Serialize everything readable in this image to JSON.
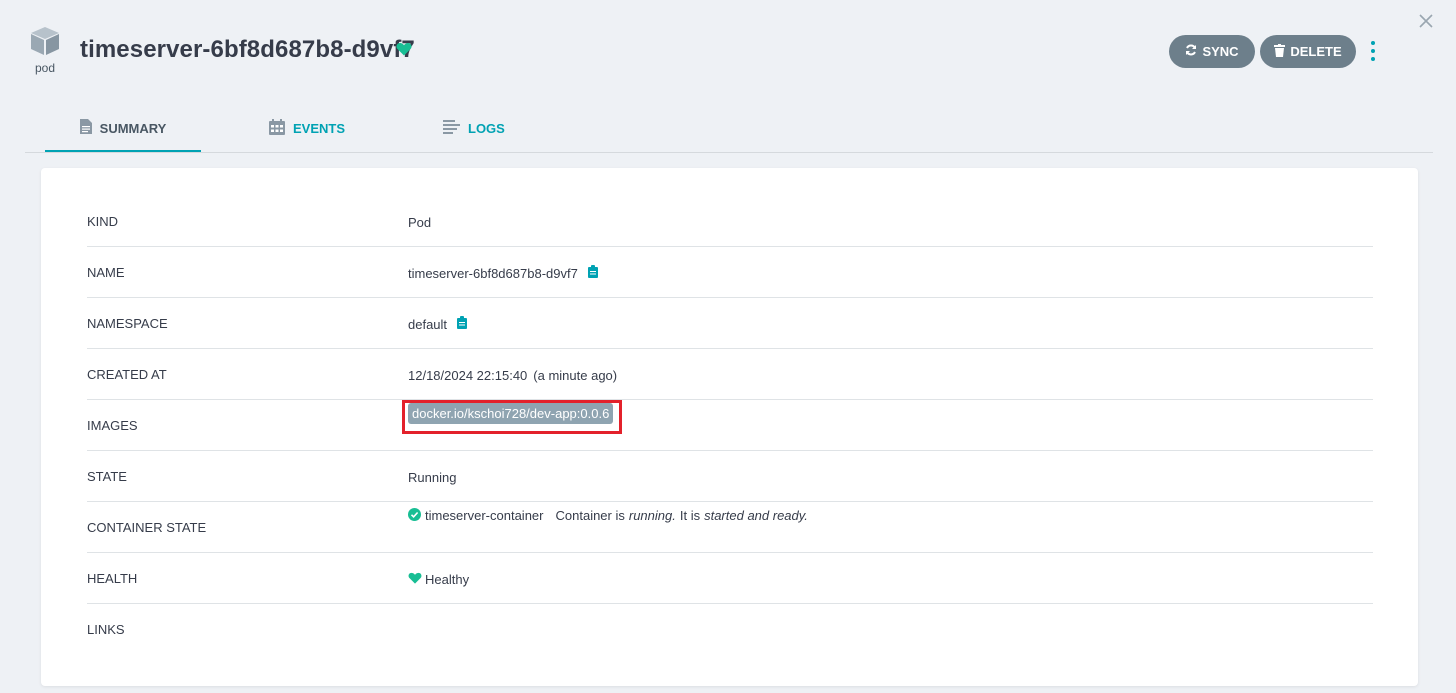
{
  "header": {
    "kind_label": "pod",
    "resource_name": "timeserver-6bf8d687b8-d9vf7",
    "sync_label": "SYNC",
    "delete_label": "DELETE"
  },
  "tabs": [
    {
      "label": "SUMMARY",
      "active": true
    },
    {
      "label": "EVENTS",
      "active": false
    },
    {
      "label": "LOGS",
      "active": false
    }
  ],
  "summary": {
    "rows": [
      {
        "key": "KIND",
        "value": "Pod"
      },
      {
        "key": "NAME",
        "value": "timeserver-6bf8d687b8-d9vf7"
      },
      {
        "key": "NAMESPACE",
        "value": "default"
      },
      {
        "key": "CREATED AT",
        "value": "12/18/2024 22:15:40",
        "relative": "(a minute ago)"
      },
      {
        "key": "IMAGES",
        "value": "docker.io/kschoi728/dev-app:0.0.6"
      },
      {
        "key": "STATE",
        "value": "Running"
      },
      {
        "key": "CONTAINER STATE",
        "container": "timeserver-container",
        "text1": "Container is",
        "state": "running.",
        "text2": "It is",
        "detail": "started and ready."
      },
      {
        "key": "HEALTH",
        "value": "Healthy"
      },
      {
        "key": "LINKS",
        "value": ""
      }
    ]
  },
  "colors": {
    "accent": "#00a2b3",
    "healthy": "#18be94",
    "button_bg": "#6d7f8b",
    "image_chip_bg": "#8fa4b1",
    "highlight_border": "#e3212b"
  },
  "icons": [
    "cube-icon",
    "heart-icon",
    "sync-icon",
    "trash-icon",
    "kebab-icon",
    "close-icon",
    "file-icon",
    "calendar-icon",
    "lines-icon",
    "clipboard-icon",
    "check-circle-icon"
  ]
}
